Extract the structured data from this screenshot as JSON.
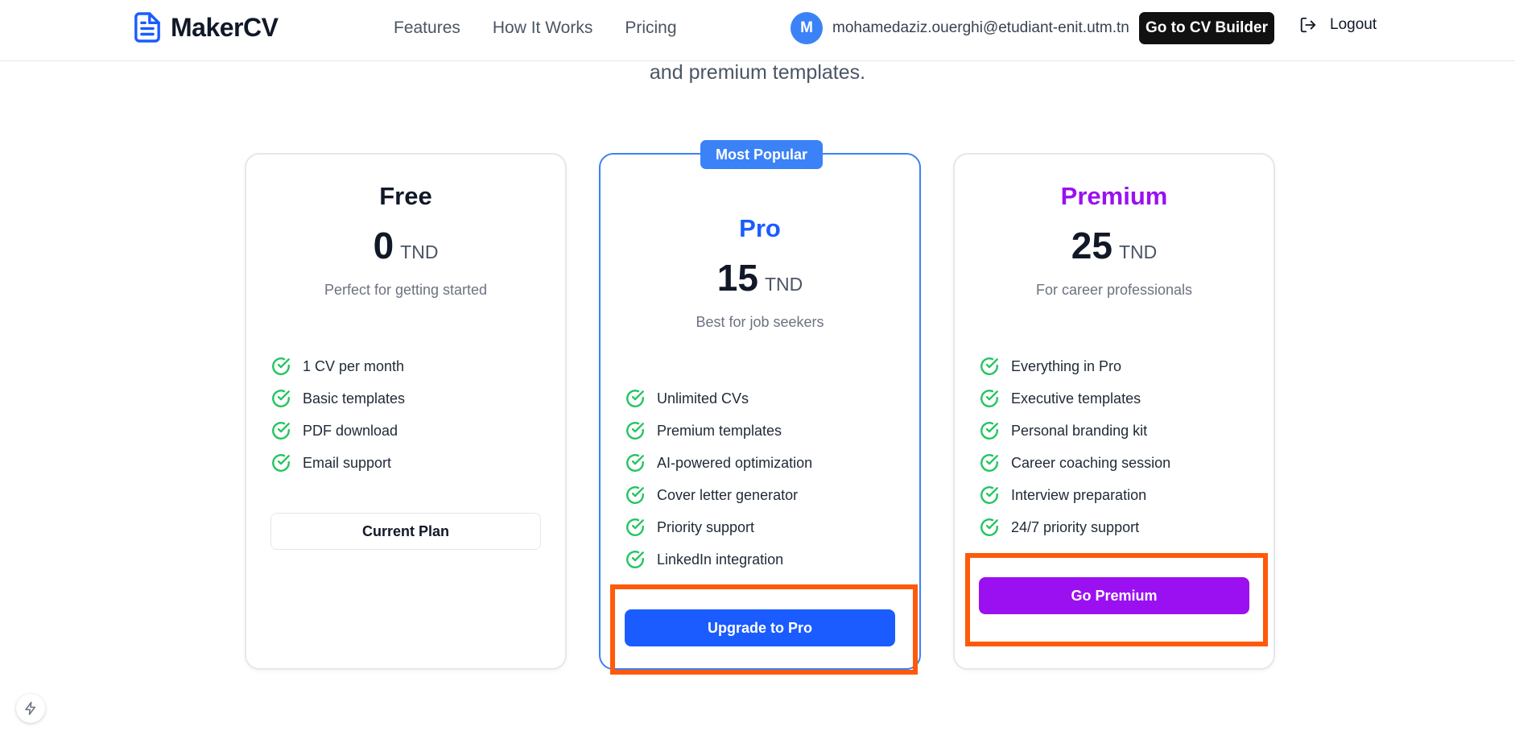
{
  "header": {
    "logo_text": "MakerCV",
    "nav": [
      {
        "label": "Features"
      },
      {
        "label": "How It Works"
      },
      {
        "label": "Pricing"
      }
    ],
    "user": {
      "avatar_initial": "M",
      "email": "mohamedaziz.ouerghi@etudiant-enit.utm.tn"
    },
    "cv_builder_button": "Go to CV Builder",
    "logout_label": "Logout"
  },
  "hero": {
    "subline": "and premium templates."
  },
  "plans": [
    {
      "name": "Free",
      "price": "0",
      "currency": "TND",
      "description": "Perfect for getting started",
      "features": [
        "1 CV per month",
        "Basic templates",
        "PDF download",
        "Email support"
      ],
      "button": "Current Plan",
      "name_color": "#111827"
    },
    {
      "badge": "Most Popular",
      "name": "Pro",
      "price": "15",
      "currency": "TND",
      "description": "Best for job seekers",
      "features": [
        "Unlimited CVs",
        "Premium templates",
        "AI-powered optimization",
        "Cover letter generator",
        "Priority support",
        "LinkedIn integration"
      ],
      "button": "Upgrade to Pro",
      "name_color": "#1a5cff"
    },
    {
      "name": "Premium",
      "price": "25",
      "currency": "TND",
      "description": "For career professionals",
      "features": [
        "Everything in Pro",
        "Executive templates",
        "Personal branding kit",
        "Career coaching session",
        "Interview preparation",
        "24/7 priority support"
      ],
      "button": "Go Premium",
      "name_color": "#9a10f0"
    }
  ],
  "colors": {
    "accent_blue": "#1a5cff",
    "premium_purple": "#9a10f0",
    "check_green": "#22c55e",
    "highlight_orange": "#ff5a0a"
  },
  "icons": {
    "logo": "document-icon",
    "check": "check-circle-icon",
    "logout": "logout-icon",
    "bolt": "bolt-icon"
  }
}
